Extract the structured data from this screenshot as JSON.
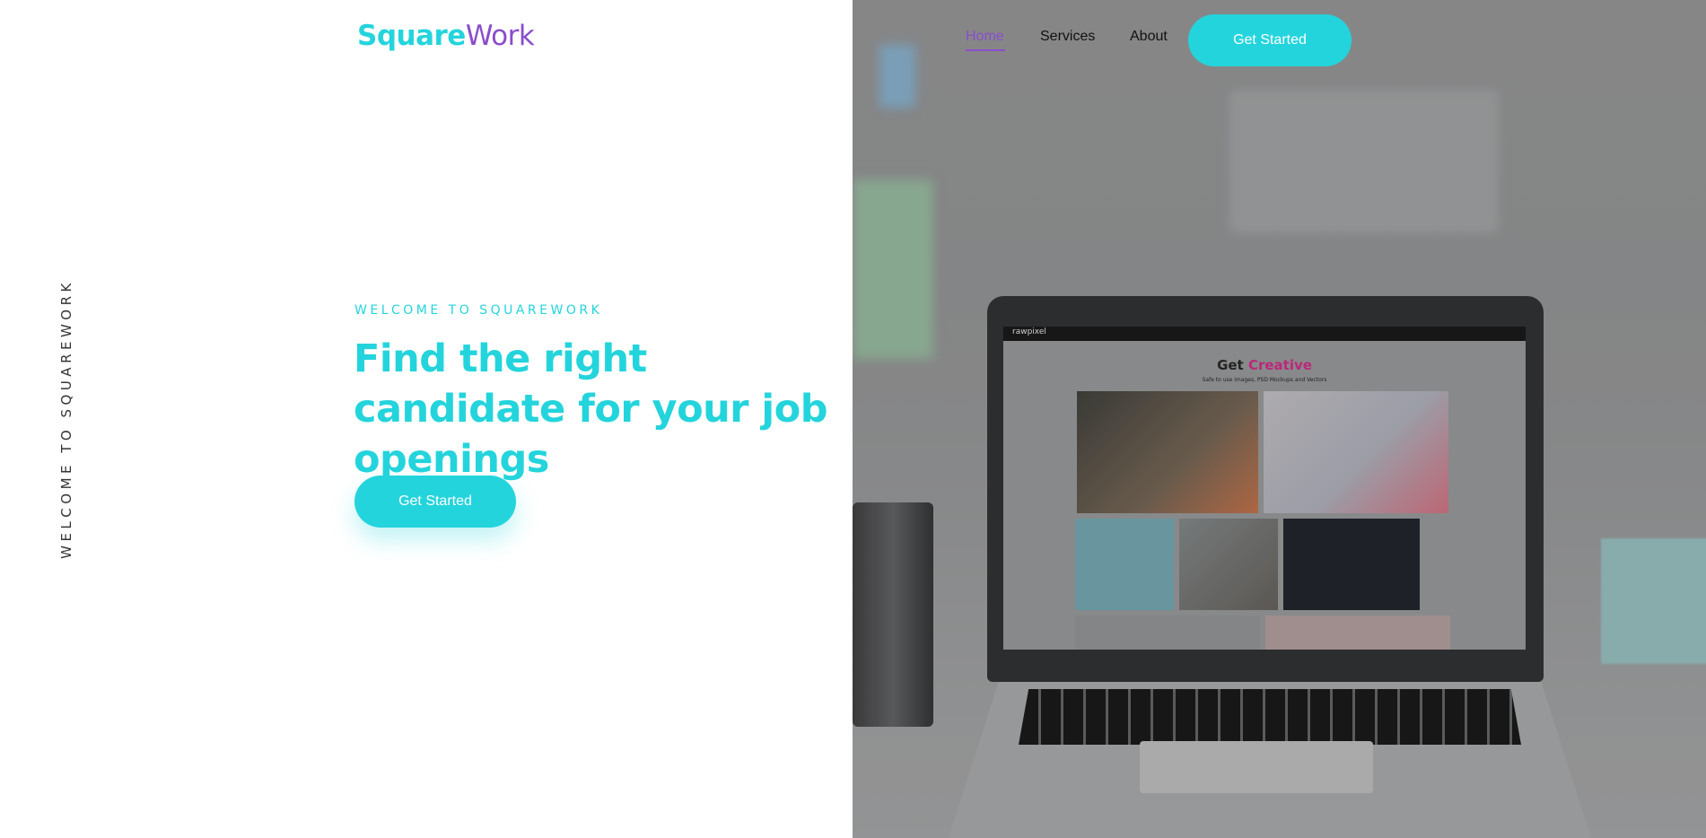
{
  "brand": {
    "part1": "Square",
    "part2": "Work"
  },
  "nav": {
    "items": [
      {
        "label": "Home",
        "active": true
      },
      {
        "label": "Services",
        "active": false
      },
      {
        "label": "About",
        "active": false
      }
    ],
    "cta_label": "Get Started"
  },
  "side_text": "WELCOME TO SQUAREWORK",
  "hero": {
    "eyebrow": "WELCOME TO SQUAREWORK",
    "headline": "Find the right candidate for your job openings",
    "cta_label": "Get Started"
  },
  "laptop_screen": {
    "brand": "rawpixel",
    "title_part1": "Get ",
    "title_part2": "Creative",
    "subtitle": "Safe to use images, PSD Mockups and Vectors"
  },
  "colors": {
    "accent": "#24d4dc",
    "brand_secondary": "#8a4dcc",
    "screen_highlight": "#c6277f"
  }
}
